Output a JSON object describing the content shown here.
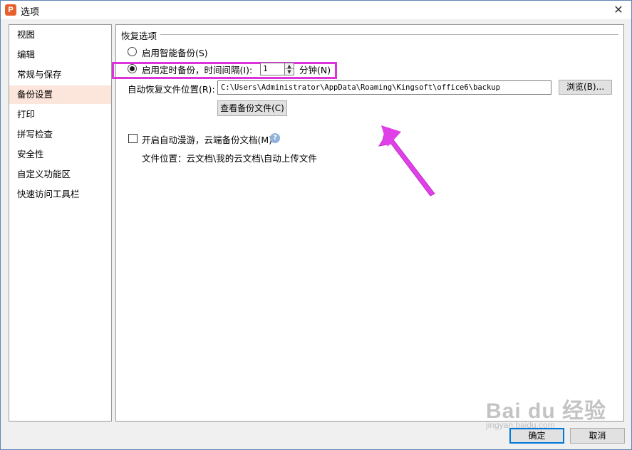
{
  "window": {
    "title": "选项",
    "app_icon_glyph": "P",
    "close_glyph": "✕"
  },
  "sidebar": {
    "items": [
      {
        "label": "视图"
      },
      {
        "label": "编辑"
      },
      {
        "label": "常规与保存"
      },
      {
        "label": "备份设置"
      },
      {
        "label": "打印"
      },
      {
        "label": "拼写检查"
      },
      {
        "label": "安全性"
      },
      {
        "label": "自定义功能区"
      },
      {
        "label": "快速访问工具栏"
      }
    ],
    "active_index": 3
  },
  "recovery": {
    "group_title": "恢复选项",
    "smart_backup_label": "启用智能备份(S)",
    "timed_backup_label": "启用定时备份，时间间隔(I):",
    "interval_value": "1",
    "interval_unit_label": "分钟(N)",
    "location_label": "自动恢复文件位置(R):",
    "location_value": "C:\\Users\\Administrator\\AppData\\Roaming\\Kingsoft\\office6\\backup",
    "browse_label": "浏览(B)...",
    "view_backup_label": "查看备份文件(C)",
    "selected_option": "timed"
  },
  "cloud": {
    "roaming_label": "开启自动漫游，云端备份文档(M)",
    "roaming_checked": false,
    "help_glyph": "?",
    "file_location_text": "文件位置：云文档\\我的云文档\\自动上传文件"
  },
  "footer": {
    "ok_label": "确定",
    "cancel_label": "取消"
  },
  "watermark": {
    "main": "Bai du 经验",
    "sub": "jingyan.baidu.com"
  },
  "colors": {
    "accent_highlight": "#dd33dd",
    "active_nav_bg": "#fce5da",
    "app_icon": "#e8612c"
  }
}
